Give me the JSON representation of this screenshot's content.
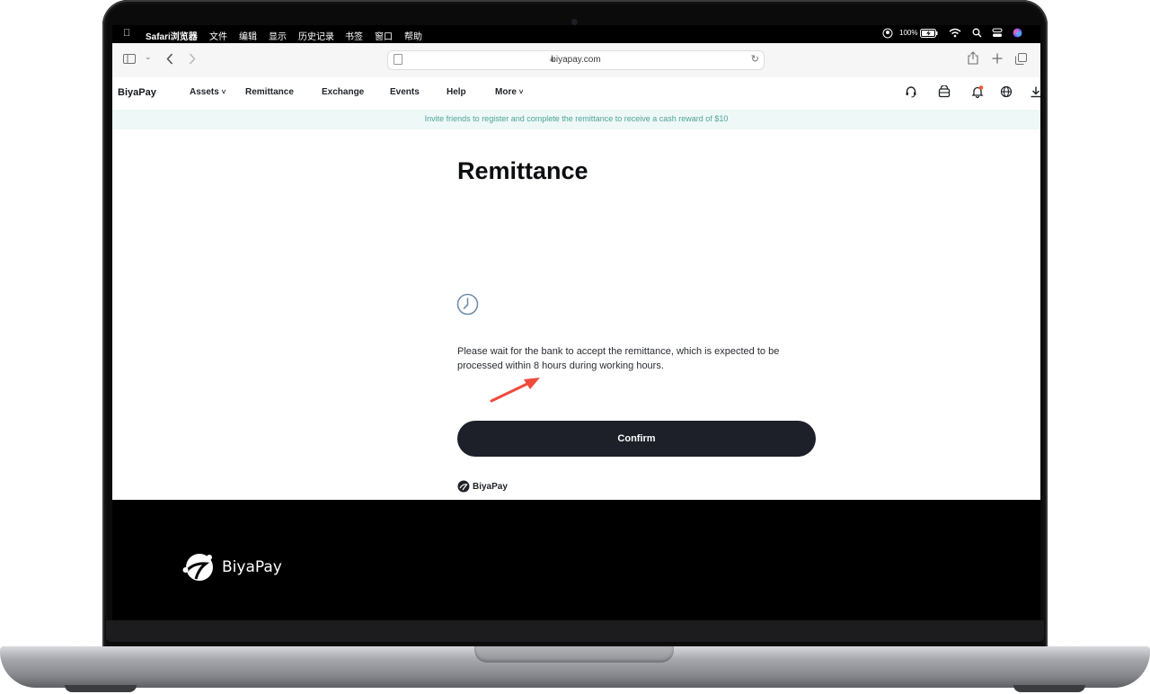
{
  "macos_menubar": {
    "app_name": "Safari浏览器",
    "items": [
      "文件",
      "编辑",
      "显示",
      "历史记录",
      "书签",
      "窗口",
      "帮助"
    ],
    "battery": "100%"
  },
  "safari": {
    "url": "biyapay.com"
  },
  "site_nav": {
    "brand": "BiyaPay",
    "items": [
      {
        "label": "Assets",
        "dropdown": true
      },
      {
        "label": "Remittance",
        "dropdown": false
      },
      {
        "label": "Exchange",
        "dropdown": false
      },
      {
        "label": "Events",
        "dropdown": false
      },
      {
        "label": "Help",
        "dropdown": false
      },
      {
        "label": "More",
        "dropdown": true
      }
    ],
    "icons": [
      "headset-icon",
      "wallet-icon",
      "bell-icon",
      "globe-icon",
      "download-icon"
    ]
  },
  "banner": {
    "text": "Invite friends to register and complete the remittance to receive a cash reward of $10"
  },
  "main": {
    "title": "Remittance",
    "status_icon": "clock-icon",
    "message": "Please wait for the bank to accept the remittance, which is expected to be processed within 8 hours during working hours.",
    "confirm_label": "Confirm",
    "footer_brand": "BiyaPay"
  },
  "footer": {
    "brand": "BiyaPay"
  },
  "colors": {
    "primary_button": "#1d2029",
    "banner_bg": "#eef8f6",
    "banner_text": "#4fa39a",
    "notification_dot": "#f05a3c",
    "annotation_arrow": "#ef4a3c"
  }
}
